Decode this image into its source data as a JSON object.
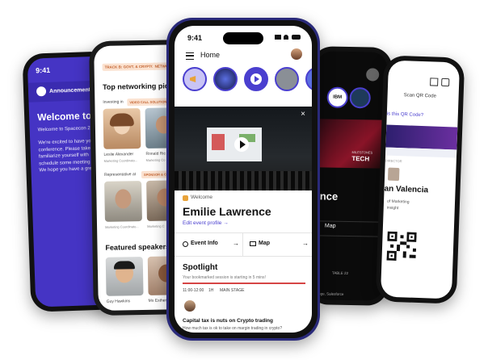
{
  "phone_left": {
    "time": "9:41",
    "announcements_label": "Announcements",
    "welcome_title": "Welcome to t",
    "welcome_sub": "Welcome to Spacecon 2",
    "body_lines": [
      "We're excited to have yo",
      "conference. Please take",
      "familiarize yourself with",
      "schedule some meeting",
      "We hope you have a gre"
    ]
  },
  "phone_networking": {
    "tag_chip_1": "TRACK B: GOVT. & CRYPTO",
    "tag_chip_2": "NETWOR",
    "title": "Top networking pick",
    "investing_label": "Investing in",
    "investing_chip": "VIDEO CALL SOLUTIONS",
    "person1_name": "Leslie Alexander",
    "person1_role": "Marketing Coordinato...",
    "person2_name": "Ronald Ric",
    "person2_role": "Marketing Co",
    "representative_label": "Representative at",
    "representative_chip": "SPONSOR & CO",
    "person3_role": "Marketing Coordinato...",
    "person4_role": "Marketing C",
    "featured_title": "Featured speakers",
    "speaker1": "Guy Hawkins",
    "speaker2": "Ms Esther"
  },
  "phone_main": {
    "time": "9:41",
    "header_title": "Home",
    "hero_close": "×",
    "welcome_label": "Welcome",
    "user_name": "Emilie Lawrence",
    "edit_profile": "Edit event profile →",
    "event_info_label": "Event Info",
    "map_label": "Map",
    "spotlight_title": "Spotlight",
    "spotlight_sub": "Your bookmarked session is starting in 5 mins!",
    "session_time": "11:00-12:00",
    "session_duration": "1H",
    "session_stage": "MAIN STAGE",
    "session_title": "Capital tax is nuts on Crypto trading",
    "session_desc": "How much tax is ok to take on margin trading in crypto?"
  },
  "phone_dark": {
    "logo": "IBM",
    "hero_word": "TECH",
    "hero_small": "MILESTONES",
    "title": "ence",
    "map_label": "Map",
    "table_label": "TABLE 22",
    "venue_text": "sge, Salesforce"
  },
  "phone_qr": {
    "tab": "Scan QR Code",
    "question": "is this QR Code?",
    "role_label": "DIRECTOR",
    "name": "an Valencia",
    "role_line1": "of Marketing",
    "role_line2": "insight"
  },
  "colors": {
    "accent": "#4a3fcf",
    "chip_bg": "#fbe2d0",
    "chip_text": "#c3622f"
  }
}
